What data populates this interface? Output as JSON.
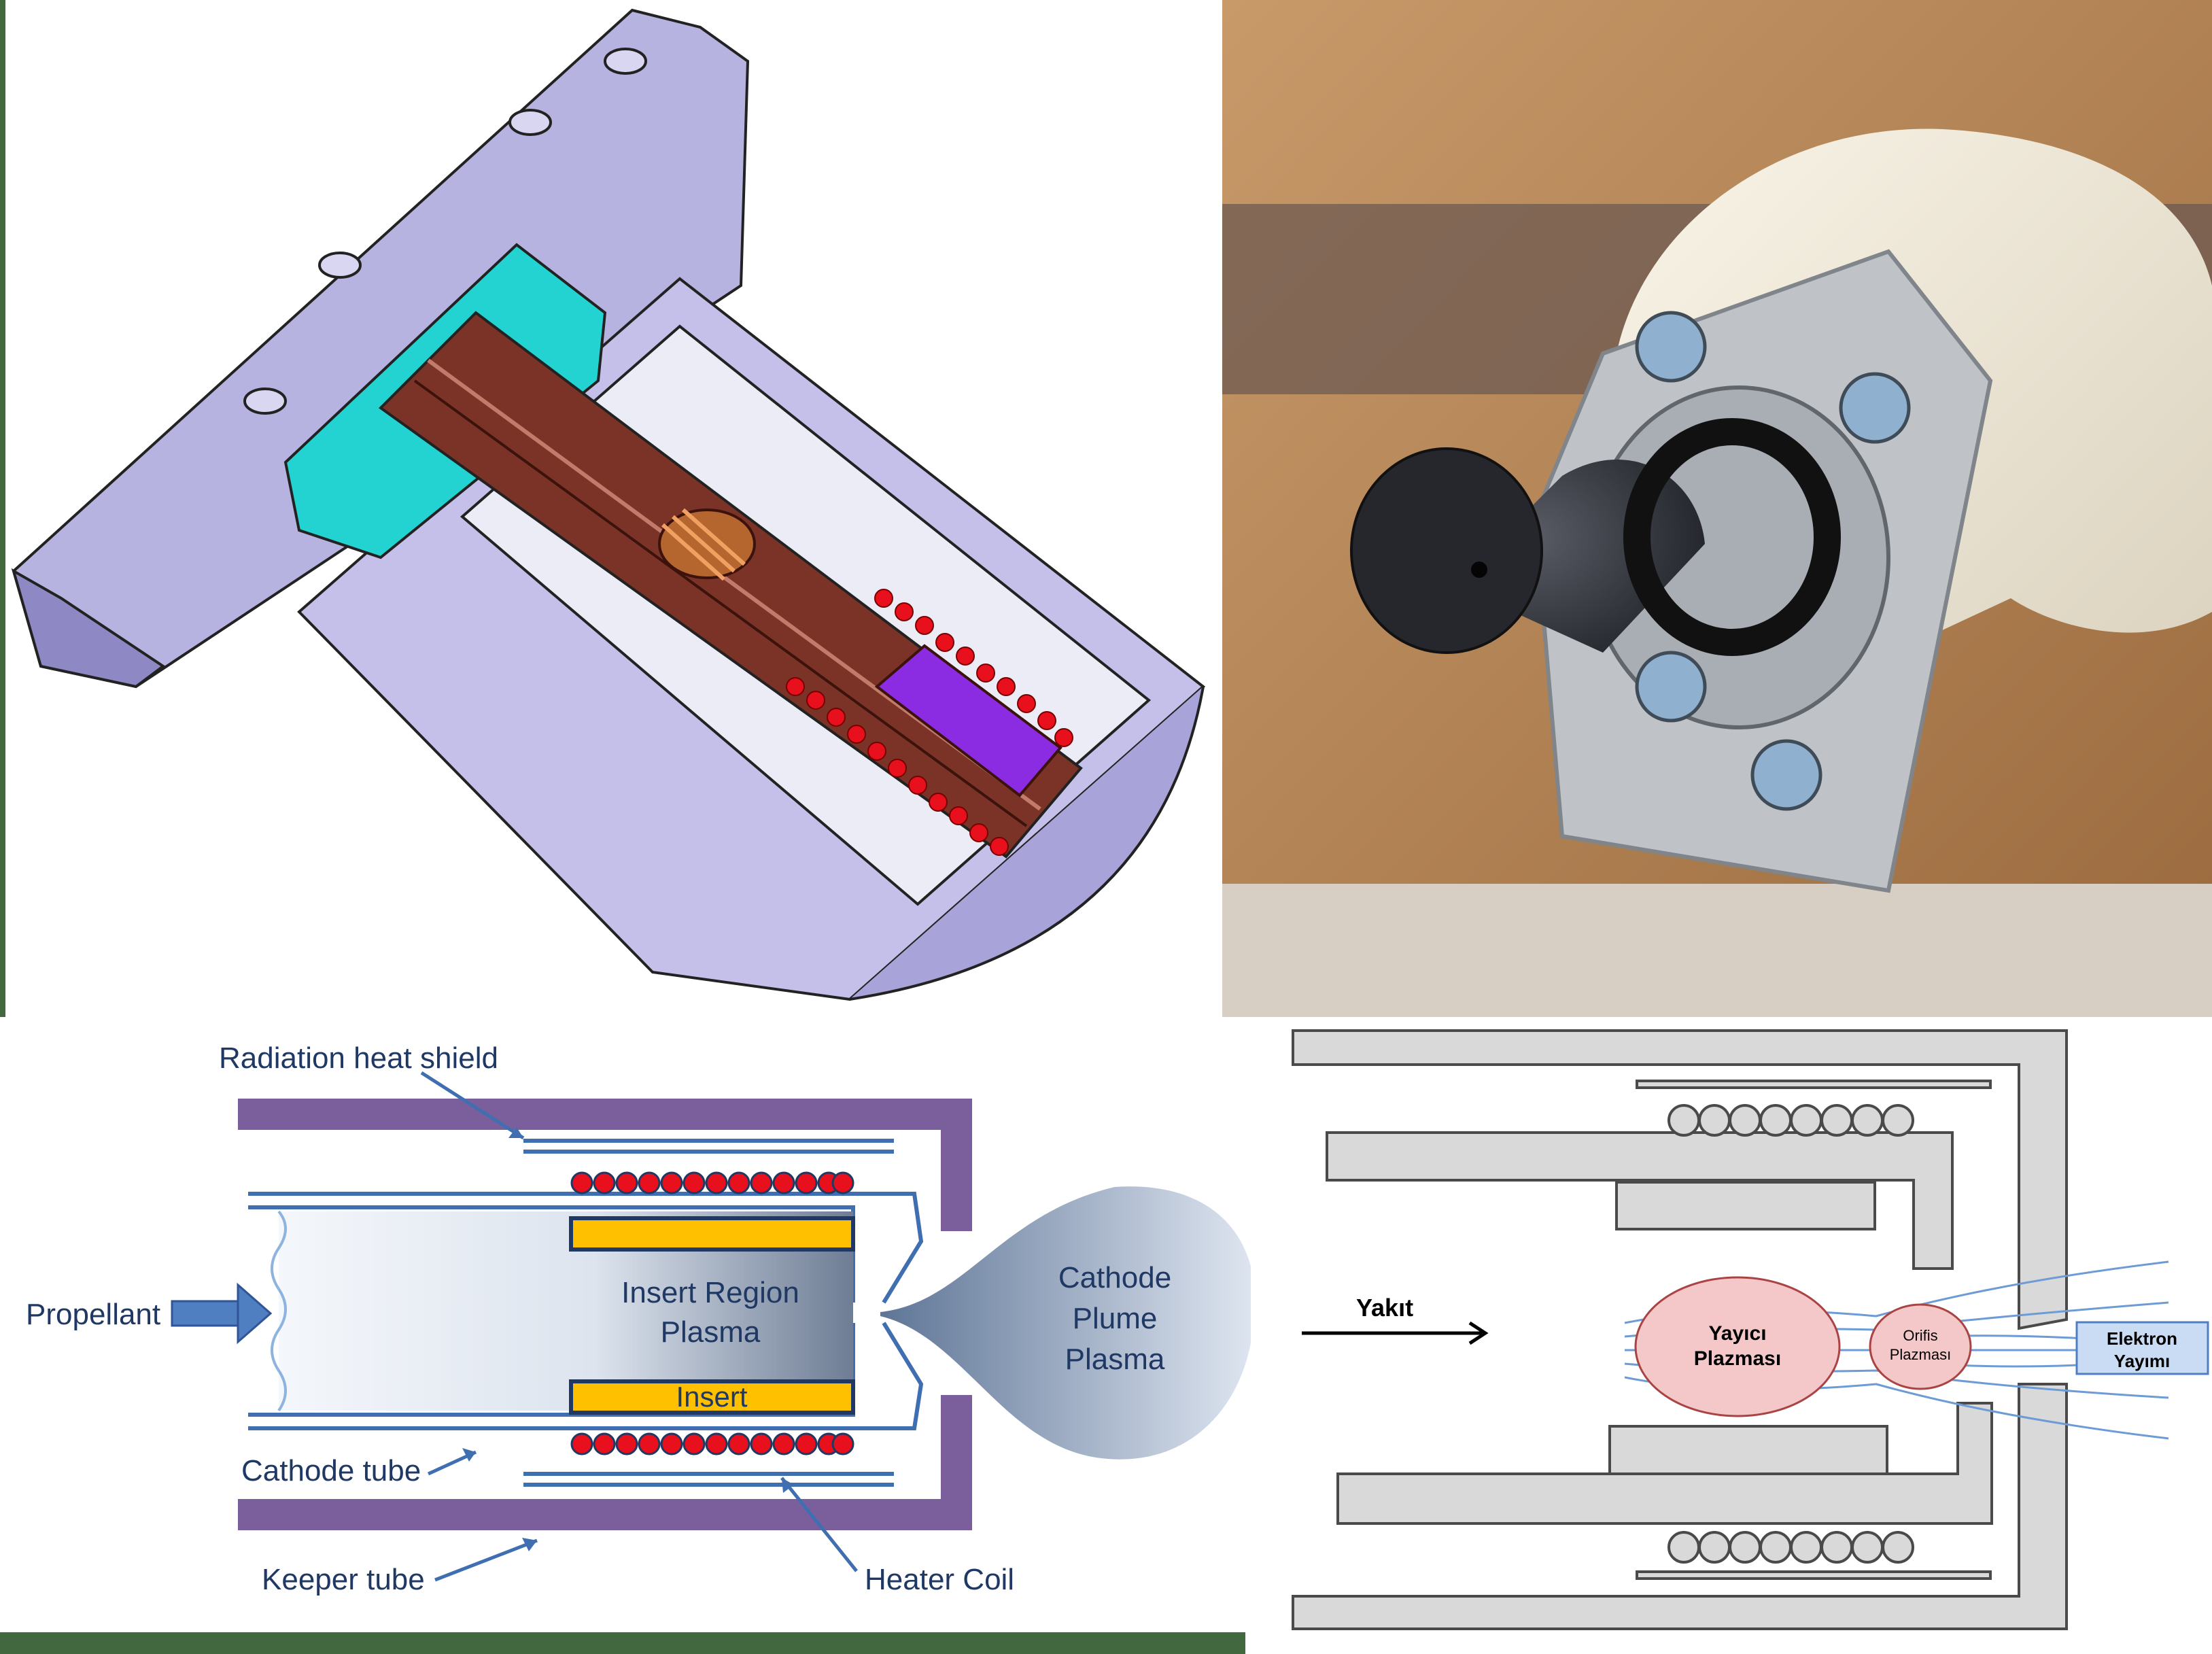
{
  "cad_section": {},
  "photo": {},
  "schematic": {
    "labels": {
      "radiation_heat_shield": "Radiation heat shield",
      "propellant": "Propellant",
      "insert_region_line1": "Insert Region",
      "insert_region_line2": "Plasma",
      "insert": "Insert",
      "cathode_plume_line1": "Cathode",
      "cathode_plume_line2": "Plume",
      "cathode_plume_line3": "Plasma",
      "cathode_tube": "Cathode tube",
      "keeper_tube": "Keeper tube",
      "heater_coil": "Heater Coil"
    },
    "colors": {
      "keeper": "#7b5f9c",
      "tube": "#3f6fb0",
      "insert": "#ffc000",
      "heater_bead": "#e8101c",
      "label": "#1f3864"
    }
  },
  "turkish_diagram": {
    "labels": {
      "yakit": "Yakıt",
      "yayici_line1": "Yayıcı",
      "yayici_line2": "Plazması",
      "orifis_line1": "Orifis",
      "orifis_line2": "Plazması",
      "elektron_line1": "Elektron",
      "elektron_line2": "Yayımı"
    },
    "colors": {
      "body": "#d9d9d9",
      "plasma": "#f4c7c8",
      "emission_box": "#c9dcf3",
      "rays": "#6d9bd6"
    }
  },
  "decor": {
    "frame_green": "#41683e"
  }
}
